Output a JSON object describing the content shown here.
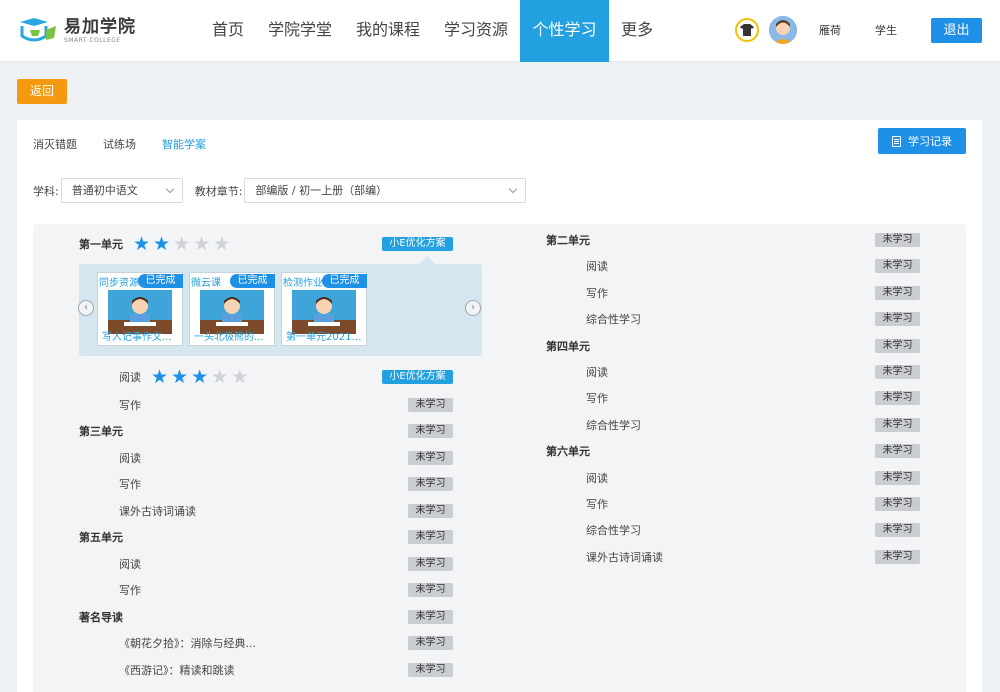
{
  "logo": {
    "cn": "易加学院",
    "en": "SMART COLLEGE"
  },
  "nav": [
    "首页",
    "学院学堂",
    "我的课程",
    "学习资源",
    "个性学习",
    "更多"
  ],
  "user": {
    "name": "雁荷",
    "role": "学生",
    "logout": "退出"
  },
  "back_label": "返回",
  "tabs": [
    "消灭错题",
    "试练场",
    "智能学案"
  ],
  "record_label": "学习记录",
  "filters": {
    "subject_label": "学科:",
    "subject_value": "普通初中语文",
    "chapter_label": "教材章节:",
    "chapter_value": "部编版 / 初一上册（部编）"
  },
  "badges": {
    "not_started": "未学习",
    "optimize": "小E优化方案"
  },
  "unit1": {
    "title": "第一单元",
    "stars": 2,
    "cards": [
      {
        "type": "同步资源",
        "status": "已完成",
        "title": "写人记事作文..."
      },
      {
        "type": "微云课",
        "status": "已完成",
        "title": "一头北极熊的..."
      },
      {
        "type": "检测作业",
        "status": "已完成",
        "title": "第一单元20210..."
      }
    ],
    "sub_reading": {
      "title": "阅读",
      "stars": 3
    },
    "sub_writing": "写作"
  },
  "left_list": [
    {
      "title": "第三单元",
      "level": "unit"
    },
    {
      "title": "阅读",
      "level": "sub"
    },
    {
      "title": "写作",
      "level": "sub"
    },
    {
      "title": "课外古诗词诵读",
      "level": "sub"
    },
    {
      "title": "第五单元",
      "level": "unit"
    },
    {
      "title": "阅读",
      "level": "sub"
    },
    {
      "title": "写作",
      "level": "sub"
    },
    {
      "title": "著名导读",
      "level": "unit"
    },
    {
      "title": "《朝花夕拾》：消除与经典...",
      "level": "sub"
    },
    {
      "title": "《西游记》：精读和跳读",
      "level": "sub"
    }
  ],
  "right_list": [
    {
      "title": "第二单元",
      "level": "unit"
    },
    {
      "title": "阅读",
      "level": "sub"
    },
    {
      "title": "写作",
      "level": "sub"
    },
    {
      "title": "综合性学习",
      "level": "sub"
    },
    {
      "title": "第四单元",
      "level": "unit"
    },
    {
      "title": "阅读",
      "level": "sub"
    },
    {
      "title": "写作",
      "level": "sub"
    },
    {
      "title": "综合性学习",
      "level": "sub"
    },
    {
      "title": "第六单元",
      "level": "unit"
    },
    {
      "title": "阅读",
      "level": "sub"
    },
    {
      "title": "写作",
      "level": "sub"
    },
    {
      "title": "综合性学习",
      "level": "sub"
    },
    {
      "title": "课外古诗词诵读",
      "level": "sub"
    }
  ]
}
